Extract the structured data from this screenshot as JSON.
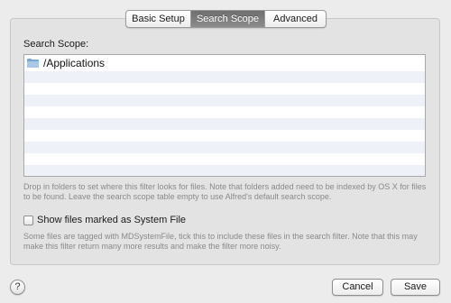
{
  "tabs": [
    {
      "label": "Basic Setup",
      "active": false
    },
    {
      "label": "Search Scope",
      "active": true
    },
    {
      "label": "Advanced",
      "active": false
    }
  ],
  "scope": {
    "label": "Search Scope:",
    "entries": [
      {
        "icon": "folder-icon",
        "path": "/Applications"
      }
    ],
    "help": "Drop in folders to set where this filter looks for files. Note that folders added need to be indexed by OS X for files to be found. Leave the search scope table empty to use Alfred's default search scope."
  },
  "system_file": {
    "label": "Show files marked as System File",
    "checked": false,
    "help": "Some files are tagged with MDSystemFile, tick this to include these files in the search filter. Note that this may make this filter return many more results and make the filter more noisy."
  },
  "footer": {
    "help_glyph": "?",
    "cancel_label": "Cancel",
    "save_label": "Save"
  },
  "colors": {
    "active_tab": "#7d7d7d",
    "alt_row": "#eef2f8",
    "folder": "#7aa7d4"
  }
}
